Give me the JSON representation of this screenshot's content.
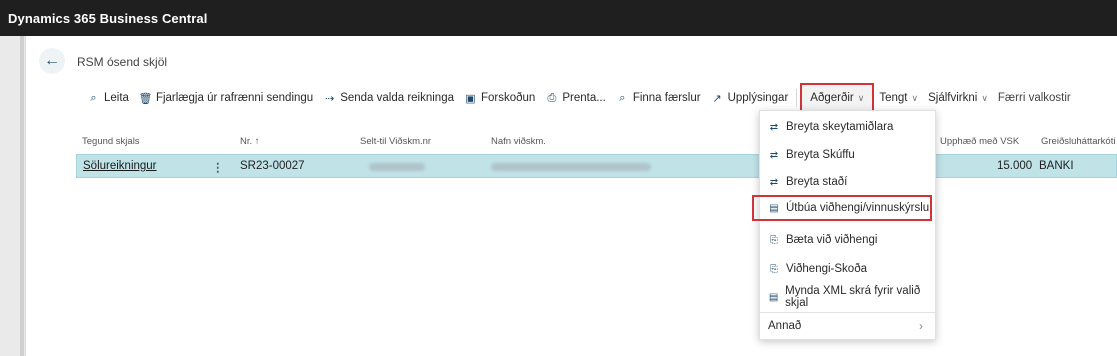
{
  "window": {
    "app_title": "Dynamics 365 Business Central"
  },
  "page": {
    "title": "RSM ósend skjöl"
  },
  "actions": [
    {
      "label": "Leita",
      "icon": "search-icon"
    },
    {
      "label": "Fjarlægja úr rafrænni sendingu",
      "icon": "delete-icon"
    },
    {
      "label": "Senda valda reikninga",
      "icon": "send-icon"
    },
    {
      "label": "Forskoðun",
      "icon": "preview-icon"
    },
    {
      "label": "Prenta...",
      "icon": "print-icon"
    },
    {
      "label": "Finna færslur",
      "icon": "find-entries-icon"
    },
    {
      "label": "Upplýsingar",
      "icon": "info-icon"
    },
    {
      "label": "Aðgerðir",
      "icon": ""
    },
    {
      "label": "Tengt",
      "icon": ""
    },
    {
      "label": "Sjálfvirkni",
      "icon": ""
    },
    {
      "label": "Færri valkostir",
      "icon": ""
    }
  ],
  "columns": [
    "Tegund skjals",
    "Nr. ↑",
    "Selt-til Viðskm.nr",
    "Nafn viðskm.",
    "Upphæð með VSK",
    "Greiðsluháttarkóti"
  ],
  "rows": [
    {
      "type": "Sölureikningur",
      "no": "SR23-00027",
      "amount": "15.000",
      "payment_code": "BANKI"
    }
  ],
  "menu": {
    "items": [
      {
        "label": "Breyta skeytamiðlara",
        "icon": "swap-icon"
      },
      {
        "label": "Breyta Skúffu",
        "icon": "swap-icon"
      },
      {
        "label": "Breyta staðí",
        "icon": "swap-icon"
      },
      {
        "label": "Útbúa viðhengi/vinnuskýrslu",
        "icon": "document-icon"
      },
      {
        "label": "Bæta við viðhengi",
        "icon": "attachment-icon"
      },
      {
        "label": "Viðhengi-Skoða",
        "icon": "attachment-icon"
      },
      {
        "label": "Mynda XML skrá fyrir valið skjal",
        "icon": "document-icon"
      },
      {
        "label": "Annað",
        "icon": ""
      }
    ]
  },
  "colors": {
    "topbar": "#1f1f1f",
    "row_selected": "#c0e3e8",
    "highlight": "#d13438"
  }
}
